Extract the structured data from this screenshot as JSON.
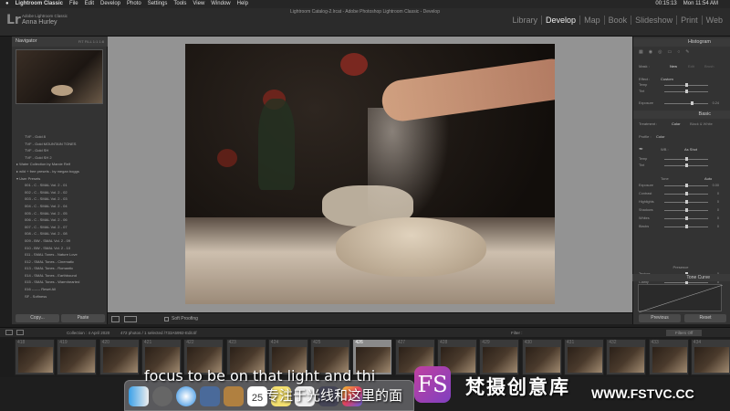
{
  "menubar": {
    "apple": "",
    "app_name": "Lightroom Classic",
    "items": [
      "File",
      "Edit",
      "Develop",
      "Photo",
      "Settings",
      "Tools",
      "View",
      "Window",
      "Help"
    ],
    "time_counter": "00:15:13",
    "datetime": "Mon 11:54 AM"
  },
  "window": {
    "title": "Lightroom Catalog-2.lrcat - Adobe Photoshop Lightroom Classic - Develop"
  },
  "identity": {
    "logo": "Lr",
    "catalog_label": "Adobe Lightroom Classic",
    "user": "Anna Hurley"
  },
  "modules": [
    "Library",
    "Develop",
    "Map",
    "Book",
    "Slideshow",
    "Print",
    "Web"
  ],
  "active_module": "Develop",
  "left_panel": {
    "navigator": "Navigator",
    "zoom": "FIT   FILL   1:1   1:8",
    "presets": [
      {
        "label": "TVF - Gold 8",
        "folder": false
      },
      {
        "label": "TVF - Gold MOUNTAIN TONES",
        "folder": false
      },
      {
        "label": "TVF - Gold SH",
        "folder": false
      },
      {
        "label": "TVF - Gold SH 2",
        "folder": false
      },
      {
        "label": "▸ Water Collection by Marcie Reif",
        "folder": true
      },
      {
        "label": "▸ wild + free presets - by megan boggs",
        "folder": true
      },
      {
        "label": "",
        "folder": true
      },
      {
        "label": "▾ User Presets",
        "folder": true
      },
      {
        "label": "001 - C - SMAL Vol. 2 - 01",
        "folder": false
      },
      {
        "label": "002 - C - SMAL Vol. 2 - 02",
        "folder": false
      },
      {
        "label": "003 - C - SMAL Vol. 2 - 03",
        "folder": false
      },
      {
        "label": "004 - C - SMAL Vol. 2 - 04",
        "folder": false
      },
      {
        "label": "005 - C - SMAL Vol. 2 - 05",
        "folder": false
      },
      {
        "label": "006 - C - SMAL Vol. 2 - 06",
        "folder": false
      },
      {
        "label": "007 - C - SMAL Vol. 2 - 07",
        "folder": false
      },
      {
        "label": "008 - C - SMAL Vol. 2 - 08",
        "folder": false
      },
      {
        "label": "009 - BW - SMAL Vol. 2 - 09",
        "folder": false
      },
      {
        "label": "010 - BW - SMAL Vol. 2 - 10",
        "folder": false
      },
      {
        "label": "011 - SMAL Tones - Nature Love",
        "folder": false
      },
      {
        "label": "012 - SMAL Tones - Cinematic",
        "folder": false
      },
      {
        "label": "013 - SMAL Tones - Romantic",
        "folder": false
      },
      {
        "label": "014 - SMAL Tones - Earthbound",
        "folder": false
      },
      {
        "label": "015 - SMAL Tones - Warmhearted",
        "folder": false
      },
      {
        "label": "016 ------- Reset All",
        "folder": false
      },
      {
        "label": "SF - Softness",
        "folder": false
      }
    ],
    "copy": "Copy...",
    "paste": "Paste"
  },
  "toolbar": {
    "soft_proofing": "Soft Proofing"
  },
  "right_panel": {
    "histogram": "Histogram",
    "mask_label": "Mask :",
    "mask_new": "New",
    "mask_edit": "Edit",
    "mask_brush": "Brush",
    "effect_label": "Effect :",
    "effect_value": "Custom",
    "temp": "Temp",
    "tint": "Tint",
    "exposure": "Exposure",
    "exposure_val": "0.24",
    "basic": "Basic",
    "treatment": "Treatment :",
    "color": "Color",
    "bw": "Black & White",
    "profile": "Profile :",
    "profile_val": "Color",
    "wb": "WB :",
    "wb_val": "As Shot",
    "temp2": "Temp",
    "tint2": "Tint",
    "tone": "Tone",
    "auto": "Auto",
    "rows": [
      {
        "label": "Exposure",
        "val": "0.00",
        "pos": 0.5
      },
      {
        "label": "Contrast",
        "val": "0",
        "pos": 0.5
      },
      {
        "label": "Highlights",
        "val": "0",
        "pos": 0.5
      },
      {
        "label": "Shadows",
        "val": "0",
        "pos": 0.5
      },
      {
        "label": "Whites",
        "val": "0",
        "pos": 0.5
      },
      {
        "label": "Blacks",
        "val": "0",
        "pos": 0.5
      }
    ],
    "presence": "Presence",
    "presence_rows": [
      {
        "label": "Texture",
        "val": "0",
        "pos": 0.5
      },
      {
        "label": "Clarity",
        "val": "0",
        "pos": 0.5
      },
      {
        "label": "Dehaze",
        "val": "0",
        "pos": 0.5
      },
      {
        "label": "Vibrance",
        "val": "0",
        "pos": 0.5
      },
      {
        "label": "Saturation",
        "val": "0",
        "pos": 0.5
      }
    ],
    "tone_curve": "Tone Curve",
    "previous": "Previous",
    "reset": "Reset"
  },
  "filmbar": {
    "left": "Collection : 4 April 2020",
    "count": "472 photos / 1 selected /733A5992-Edit.tif",
    "filter": "Filter :",
    "filters_off": "Filters Off"
  },
  "filmstrip": {
    "numbers": [
      "418",
      "419",
      "420",
      "421",
      "422",
      "423",
      "424",
      "425",
      "426",
      "427",
      "428",
      "429",
      "430",
      "431",
      "432",
      "433",
      "434"
    ],
    "selected": "426"
  },
  "overlay": {
    "subtitle_en": "focus to be on that light and thi",
    "subtitle_cn": "专注于光线和这里的面",
    "watermark_logo": "FS",
    "watermark_text": "梵摄创意库",
    "watermark_url": "WWW.FSTVC.CC"
  },
  "dock": {
    "calendar_day": "25"
  }
}
